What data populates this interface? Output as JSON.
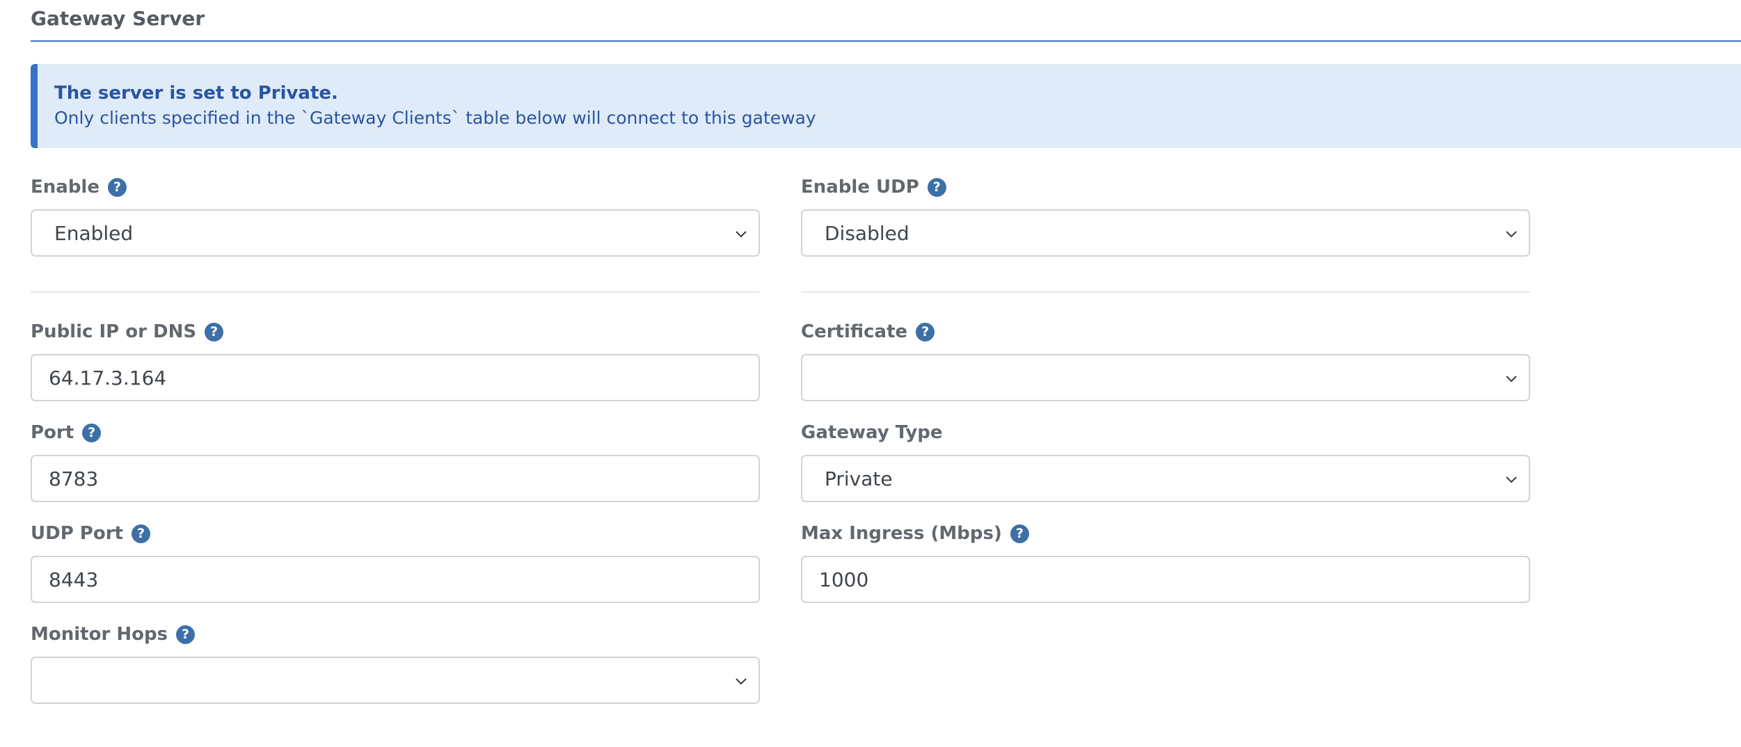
{
  "section": {
    "title": "Gateway Server"
  },
  "alert": {
    "title": "The server is set to Private.",
    "text": "Only clients specified in the `Gateway Clients` table below will connect to this gateway"
  },
  "fields": {
    "enable": {
      "label": "Enable",
      "value": "Enabled"
    },
    "enable_udp": {
      "label": "Enable UDP",
      "value": "Disabled"
    },
    "public_ip": {
      "label": "Public IP or DNS",
      "value": "64.17.3.164"
    },
    "certificate": {
      "label": "Certificate",
      "value": ""
    },
    "port": {
      "label": "Port",
      "value": "8783"
    },
    "gateway_type": {
      "label": "Gateway Type",
      "value": "Private"
    },
    "udp_port": {
      "label": "UDP Port",
      "value": "8443"
    },
    "max_ingress": {
      "label": "Max Ingress (Mbps)",
      "value": "1000"
    },
    "monitor_hops": {
      "label": "Monitor Hops",
      "value": ""
    }
  },
  "icons": {
    "help": "question-circle-icon",
    "dropdown": "chevron-down-icon"
  },
  "help_glyph": "?",
  "colors": {
    "accent": "#3d73b8",
    "alert_bg": "#dfebf8",
    "alert_border": "#3a72c9",
    "alert_text": "#2a55a0",
    "help_icon": "#3d6fa8"
  }
}
